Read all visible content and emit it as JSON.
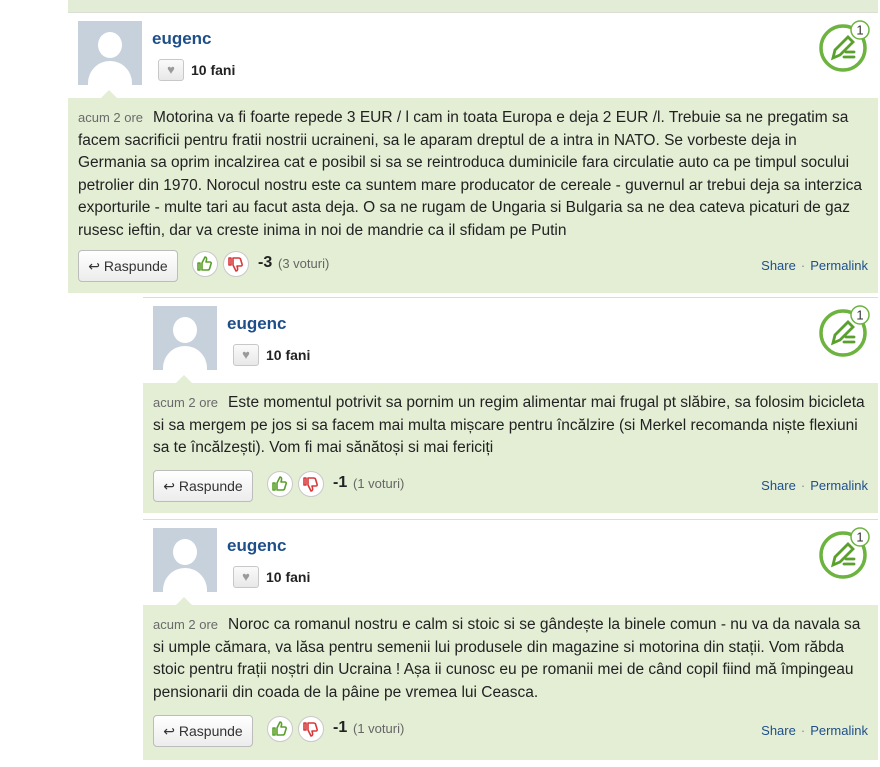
{
  "comments": [
    {
      "username": "eugenc",
      "fans": "10 fani",
      "badge_count": "1",
      "time": "acum 2 ore",
      "text": "Motorina va fi foarte repede 3 EUR / l cam in toata Europa e deja 2 EUR /l. Trebuie sa ne pregatim sa facem sacrificii pentru fratii nostrii ucraineni, sa le aparam dreptul de a intra in NATO. Se vorbeste deja in Germania sa oprim incalzirea cat e posibil si sa se reintroduca duminicile fara circulatie auto ca pe timpul socului petrolier din 1970. Norocul nostru este ca suntem mare producator de cereale - guvernul ar trebui deja sa interzica exporturile - multe tari au facut asta deja. O sa ne rugam de Ungaria si Bulgaria sa ne dea cateva picaturi de gaz rusesc ieftin, dar va creste inima in noi de mandrie ca il sfidam pe Putin",
      "reply_label": "Raspunde",
      "score": "-3",
      "votes": "(3 voturi)",
      "share": "Share",
      "permalink": "Permalink"
    },
    {
      "username": "eugenc",
      "fans": "10 fani",
      "badge_count": "1",
      "time": "acum 2 ore",
      "text": "Este momentul potrivit sa pornim un regim alimentar mai frugal pt slăbire, sa folosim bicicleta si sa mergem pe jos si sa facem mai multa mișcare pentru încălzire (si Merkel recomanda niște flexiuni sa te încălzești). Vom fi mai sănătoși si mai fericiți",
      "reply_label": "Raspunde",
      "score": "-1",
      "votes": "(1 voturi)",
      "share": "Share",
      "permalink": "Permalink"
    },
    {
      "username": "eugenc",
      "fans": "10 fani",
      "badge_count": "1",
      "time": "acum 2 ore",
      "text": "Noroc ca romanul nostru e calm si stoic si se gândește la binele comun - nu va da navala sa si umple cămara, va lăsa pentru semenii lui produsele din magazine si motorina din stații. Vom răbda stoic pentru frații noștri din Ucraina ! Așa ii cunosc eu pe romanii mei de când copil fiind mă împingeau pensionarii din coada de la pâine pe vremea lui Ceasca.",
      "reply_label": "Raspunde",
      "score": "-1",
      "votes": "(1 voturi)",
      "share": "Share",
      "permalink": "Permalink"
    }
  ],
  "icons": {
    "reply": "reply-arrow-icon",
    "heart": "heart-icon",
    "thumbs_up": "thumbs-up-icon",
    "thumbs_down": "thumbs-down-icon",
    "badge": "pencil-badge-icon"
  },
  "colors": {
    "body_bg": "#e3eed5",
    "link": "#1f4f8a",
    "badge_green": "#6db33f",
    "thumbs_down_red": "#d9383a"
  }
}
